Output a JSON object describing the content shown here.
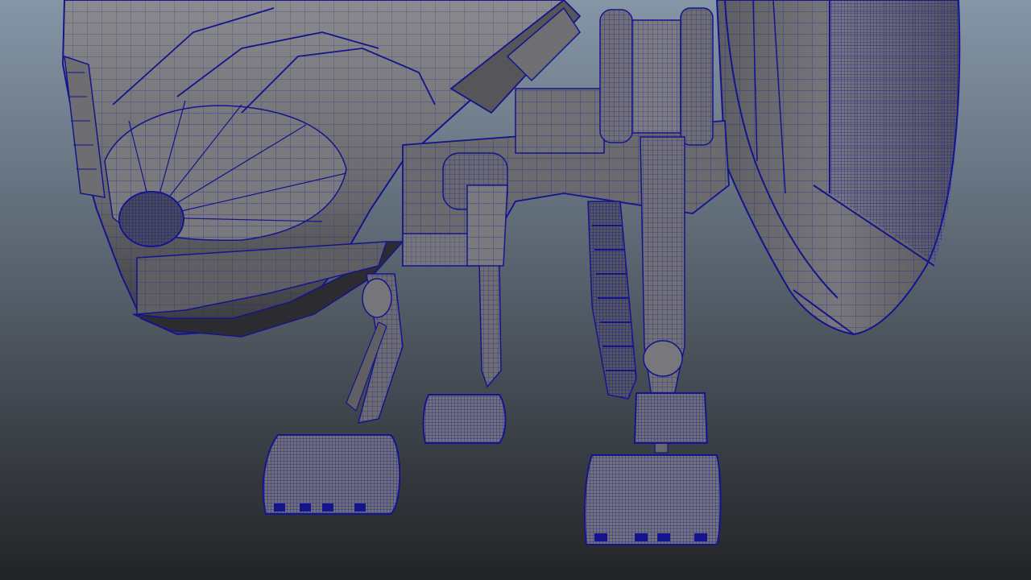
{
  "viewport": {
    "background_top": "#8596a7",
    "background_bottom": "#232427",
    "wire_color": "#14148c",
    "surface_color": "#6b6b6f",
    "surface_light": "#8a8a8e",
    "surface_dark": "#3c3c40"
  },
  "model": {
    "parts": [
      "hull-nose",
      "hull-rear-dome",
      "sensor-port",
      "front-left-leg",
      "center-leg",
      "hydraulic-piston",
      "rear-right-leg",
      "front-left-foot",
      "center-foot",
      "rear-foot",
      "right-small-foot",
      "gear-cylinders"
    ]
  }
}
